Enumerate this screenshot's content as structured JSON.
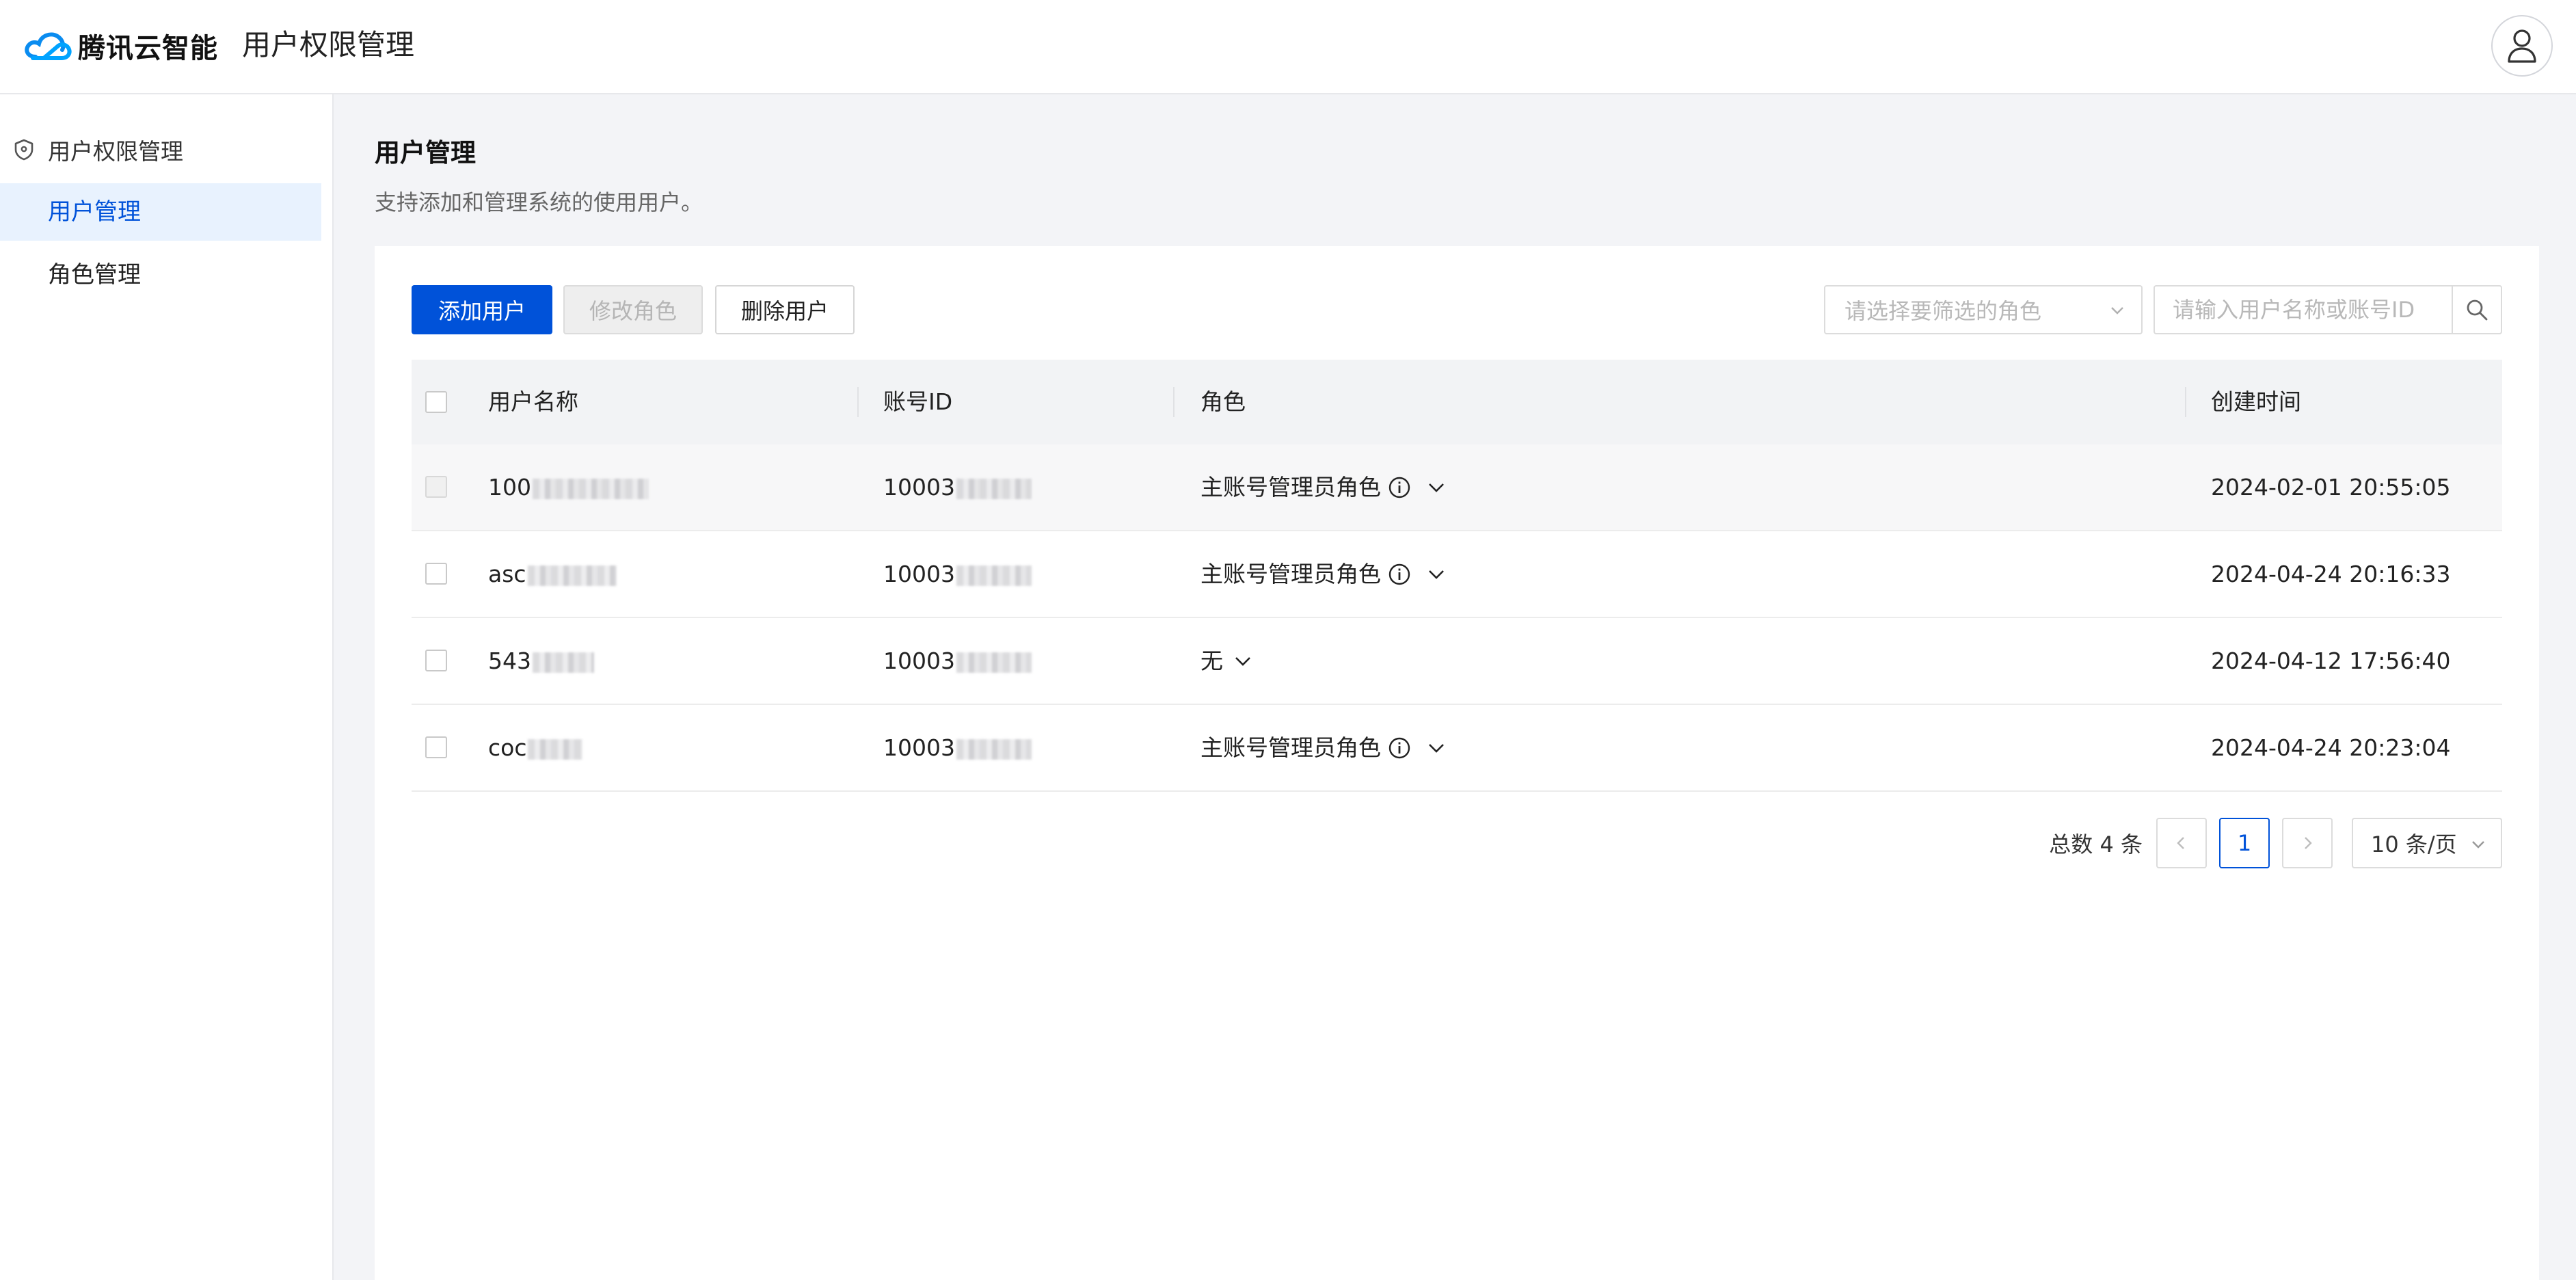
{
  "header": {
    "brand_name": "腾讯云智能",
    "app_title": "用户权限管理",
    "icons": {
      "logo": "tencent-cloud-logo",
      "user": "user-icon"
    }
  },
  "sidebar": {
    "group_label": "用户权限管理",
    "group_icon": "shield-icon",
    "items": [
      {
        "label": "用户管理",
        "active": true
      },
      {
        "label": "角色管理",
        "active": false
      }
    ]
  },
  "page": {
    "title": "用户管理",
    "description": "支持添加和管理系统的使用用户。"
  },
  "toolbar": {
    "add_label": "添加用户",
    "edit_role_label": "修改角色",
    "delete_label": "删除用户",
    "role_filter_placeholder": "请选择要筛选的角色",
    "search_placeholder": "请输入用户名称或账号ID"
  },
  "table": {
    "columns": [
      "用户名称",
      "账号ID",
      "角色",
      "创建时间"
    ],
    "rows": [
      {
        "username": "100",
        "account_id": "10003",
        "role": "主账号管理员角色",
        "role_info": true,
        "created": "2024-02-01 20:55:05"
      },
      {
        "username": "asc",
        "account_id": "10003",
        "role": "主账号管理员角色",
        "role_info": true,
        "created": "2024-04-24 20:16:33"
      },
      {
        "username": "543",
        "account_id": "10003",
        "role": "无",
        "role_info": false,
        "created": "2024-04-12 17:56:40"
      },
      {
        "username": "coc",
        "account_id": "10003",
        "role": "主账号管理员角色",
        "role_info": true,
        "created": "2024-04-24 20:23:04"
      }
    ]
  },
  "pagination": {
    "total_text": "总数 4 条",
    "current_page": "1",
    "page_size": "10 条/页"
  },
  "colors": {
    "primary": "#0052d9",
    "active_bg": "#e8f2fe",
    "page_bg": "#f3f4f7"
  }
}
